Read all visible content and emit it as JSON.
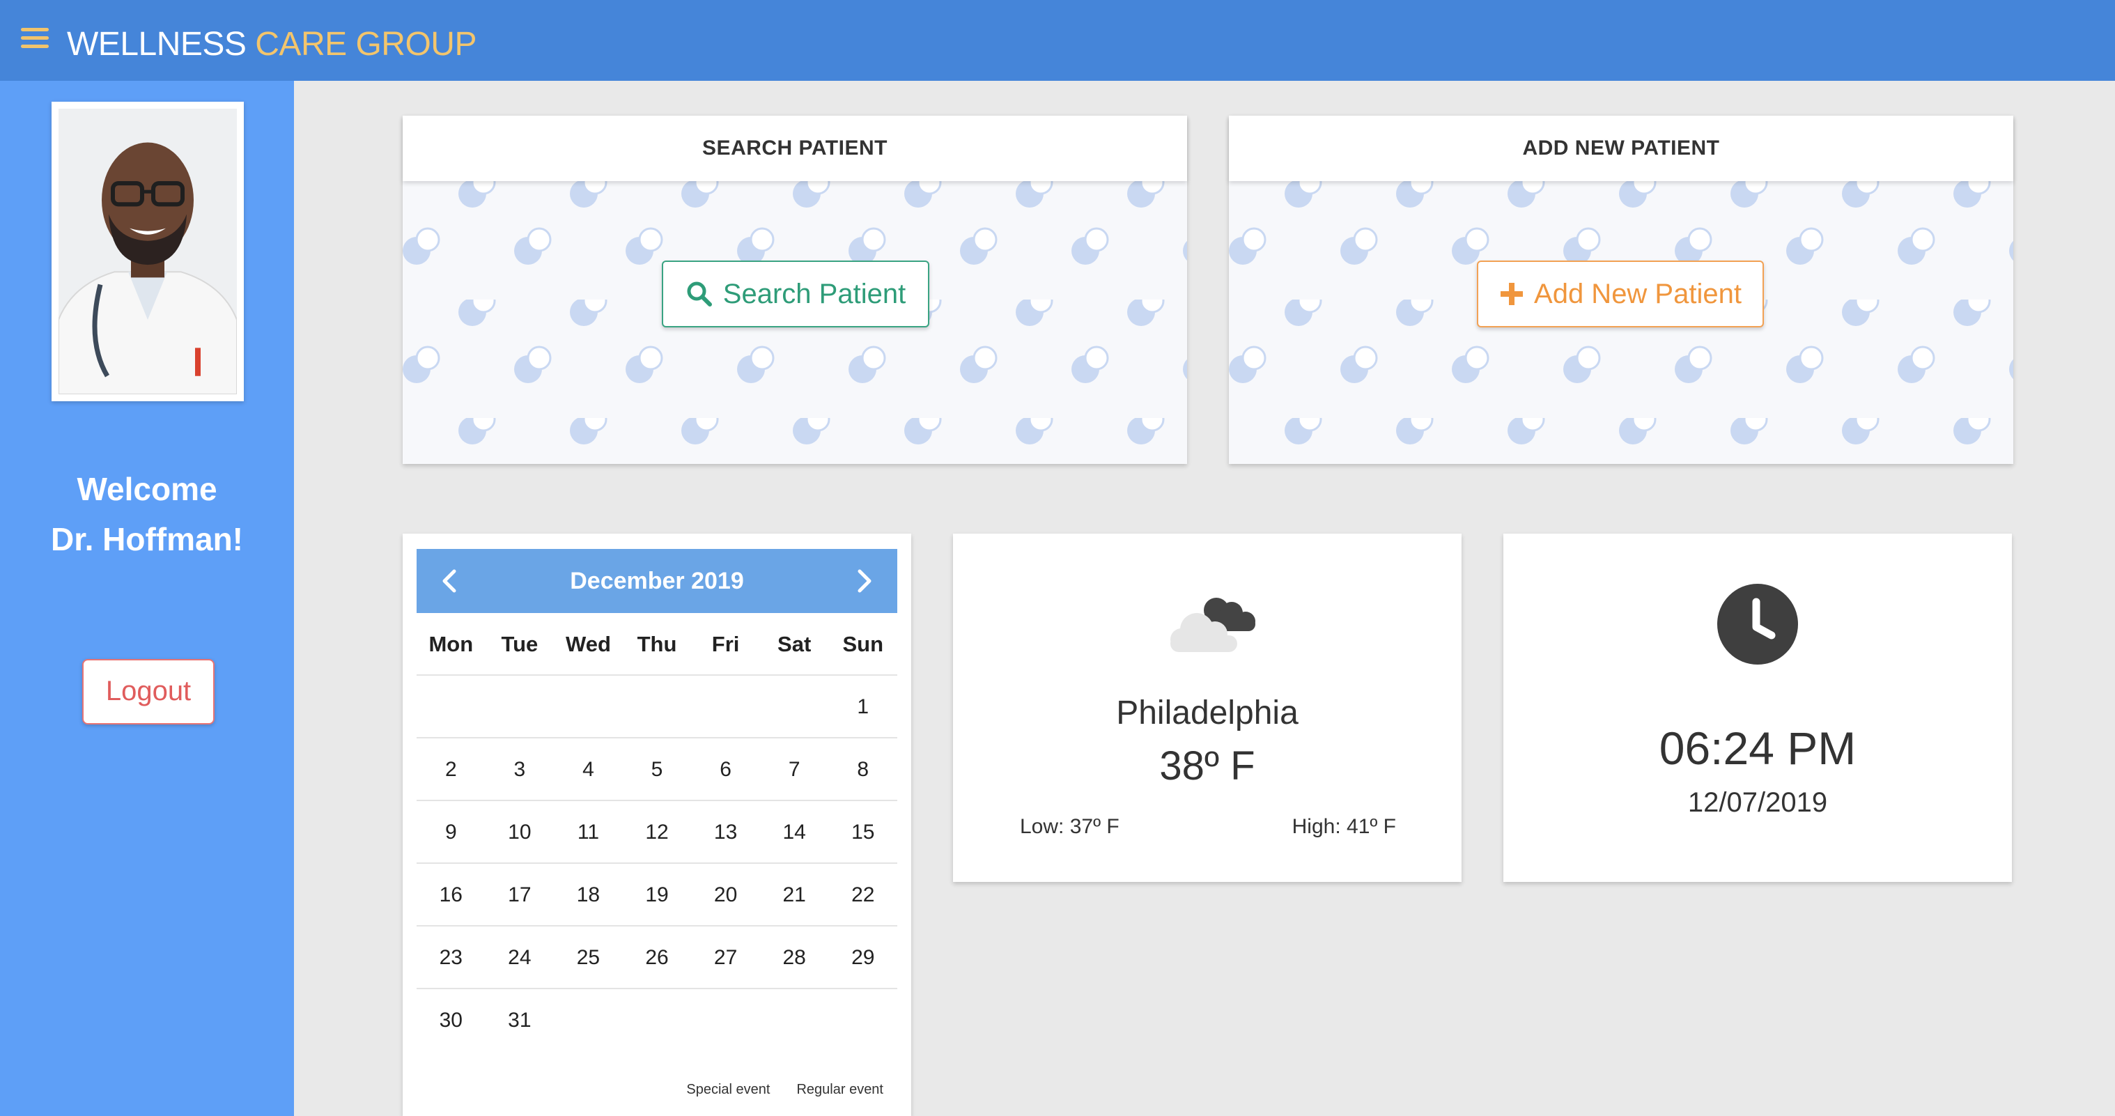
{
  "header": {
    "brand_part1": "WELLNESS",
    "brand_part2": "CARE GROUP",
    "menu_icon": "hamburger-menu-icon"
  },
  "sidebar": {
    "welcome_line1": "Welcome",
    "welcome_line2": "Dr. Hoffman!",
    "logout_label": "Logout"
  },
  "search_card": {
    "title": "SEARCH PATIENT",
    "button_label": "Search Patient",
    "button_icon": "search-icon"
  },
  "add_card": {
    "title": "ADD NEW PATIENT",
    "button_label": "Add New Patient",
    "button_icon": "plus-icon"
  },
  "calendar": {
    "month_label": "December 2019",
    "weekdays": [
      "Mon",
      "Tue",
      "Wed",
      "Thu",
      "Fri",
      "Sat",
      "Sun"
    ],
    "weeks": [
      [
        "",
        "",
        "",
        "",
        "",
        "",
        "1"
      ],
      [
        "2",
        "3",
        "4",
        "5",
        "6",
        "7",
        "8"
      ],
      [
        "9",
        "10",
        "11",
        "12",
        "13",
        "14",
        "15"
      ],
      [
        "16",
        "17",
        "18",
        "19",
        "20",
        "21",
        "22"
      ],
      [
        "23",
        "24",
        "25",
        "26",
        "27",
        "28",
        "29"
      ],
      [
        "30",
        "31",
        "",
        "",
        "",
        "",
        ""
      ]
    ],
    "legend_special": "Special event",
    "legend_regular": "Regular event"
  },
  "weather": {
    "icon": "partly-cloudy-icon",
    "city": "Philadelphia",
    "temperature": "38º F",
    "low": "Low: 37º F",
    "high": "High: 41º F"
  },
  "clock": {
    "icon": "clock-icon",
    "time": "06:24 PM",
    "date": "12/07/2019"
  },
  "colors": {
    "topbar": "#4585d9",
    "sidebar": "#5e9ff7",
    "brand_accent": "#f3c56c",
    "search_button": "#2e9c78",
    "add_button": "#f0963d",
    "logout": "#e05c5c",
    "calendar_header": "#6aa5e6"
  }
}
